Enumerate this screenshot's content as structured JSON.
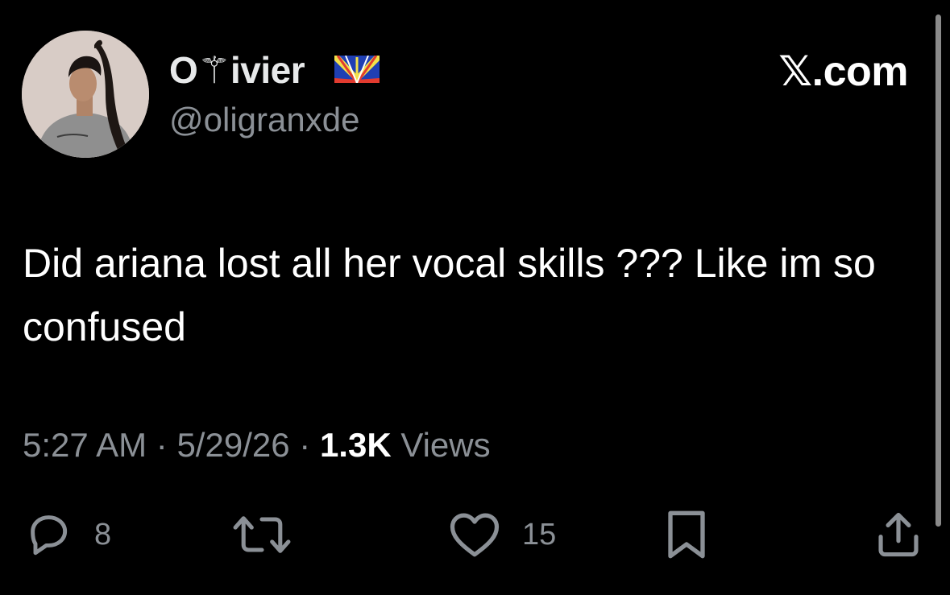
{
  "tweet": {
    "display_name": "O⚚ivier",
    "flag": "flag-icon",
    "handle": "@oligranxde",
    "text": "Did ariana lost all her vocal skills ??? Like im so confused",
    "time": "5:27 AM",
    "date": "5/29/26",
    "views_count": "1.3K",
    "views_label": "Views",
    "separator": "·"
  },
  "brand": "𝕏.com",
  "actions": {
    "reply": {
      "icon": "reply-icon",
      "count": "8"
    },
    "retweet": {
      "icon": "retweet-icon",
      "count": ""
    },
    "like": {
      "icon": "heart-icon",
      "count": "15"
    },
    "bookmark": {
      "icon": "bookmark-icon",
      "count": ""
    },
    "share": {
      "icon": "share-icon",
      "count": ""
    }
  },
  "colors": {
    "background": "#000000",
    "text_primary": "#ffffff",
    "text_secondary": "#8b9096"
  }
}
